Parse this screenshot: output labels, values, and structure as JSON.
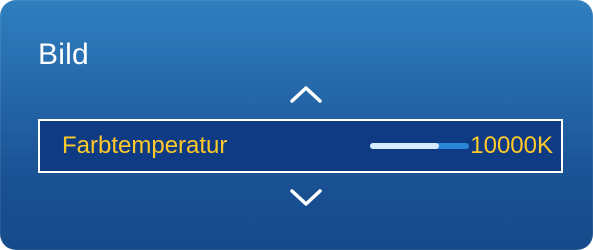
{
  "menu": {
    "title": "Bild"
  },
  "setting": {
    "label": "Farbtemperatur",
    "value": "10000K",
    "slider_fraction": 0.7
  },
  "icons": {
    "up": "chevron-up-icon",
    "down": "chevron-down-icon"
  },
  "colors": {
    "accent_text": "#ffc929",
    "panel_blue": "#1f5fa3",
    "row_blue": "#0e3b84",
    "slider_fill": "#d7ecff"
  }
}
